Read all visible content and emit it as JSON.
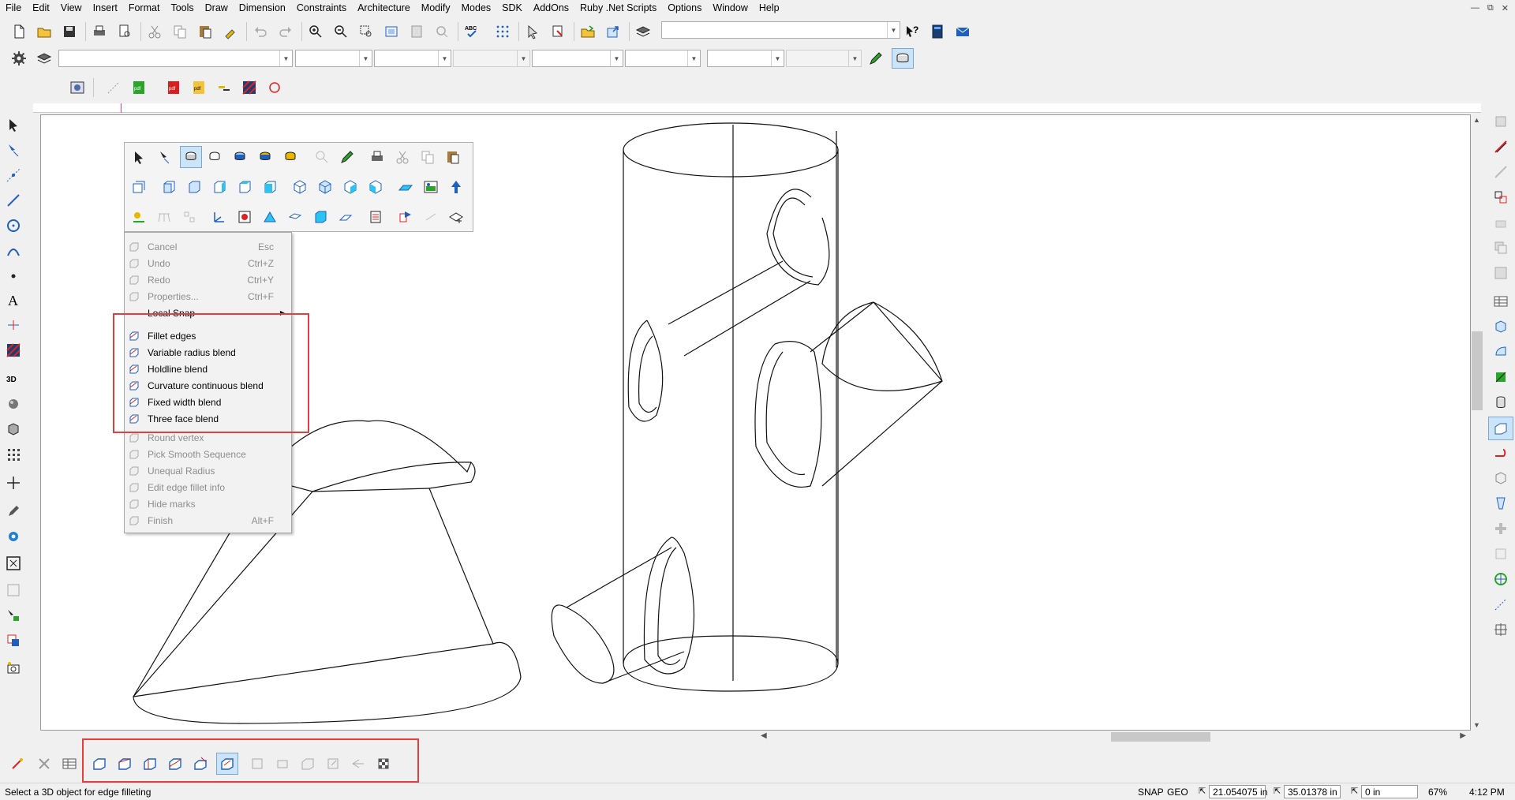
{
  "menu": [
    "File",
    "Edit",
    "View",
    "Insert",
    "Format",
    "Tools",
    "Draw",
    "Dimension",
    "Constraints",
    "Architecture",
    "Modify",
    "Modes",
    "SDK",
    "AddOns",
    "Ruby .Net Scripts",
    "Options",
    "Window",
    "Help"
  ],
  "toolbar1": {
    "abc_label": "ABC"
  },
  "context_menu": {
    "items": [
      {
        "label": "Cancel",
        "shortcut": "Esc",
        "enabled": false,
        "icon": "cancel-icon"
      },
      {
        "label": "Undo",
        "shortcut": "Ctrl+Z",
        "enabled": false,
        "icon": "undo-icon"
      },
      {
        "label": "Redo",
        "shortcut": "Ctrl+Y",
        "enabled": false,
        "icon": "redo-icon"
      },
      {
        "label": "Properties...",
        "shortcut": "Ctrl+F",
        "enabled": false,
        "icon": "properties-icon"
      },
      {
        "label": "Local Snap",
        "shortcut": "",
        "enabled": true,
        "icon": "",
        "submenu": true
      },
      {
        "label": "Fillet edges",
        "shortcut": "",
        "enabled": true,
        "icon": "fillet-edges-icon"
      },
      {
        "label": "Variable radius blend",
        "shortcut": "",
        "enabled": true,
        "icon": "variable-radius-blend-icon"
      },
      {
        "label": "Holdline blend",
        "shortcut": "",
        "enabled": true,
        "icon": "holdline-blend-icon"
      },
      {
        "label": "Curvature continuous blend",
        "shortcut": "",
        "enabled": true,
        "icon": "curvature-continuous-blend-icon"
      },
      {
        "label": "Fixed width blend",
        "shortcut": "",
        "enabled": true,
        "icon": "fixed-width-blend-icon"
      },
      {
        "label": "Three face blend",
        "shortcut": "",
        "enabled": true,
        "icon": "three-face-blend-icon"
      },
      {
        "label": "Round vertex",
        "shortcut": "",
        "enabled": false,
        "icon": "round-vertex-icon"
      },
      {
        "label": "Pick Smooth Sequence",
        "shortcut": "",
        "enabled": false,
        "icon": "pick-smooth-sequence-icon"
      },
      {
        "label": "Unequal Radius",
        "shortcut": "",
        "enabled": false,
        "icon": "unequal-radius-icon"
      },
      {
        "label": "Edit edge fillet info",
        "shortcut": "",
        "enabled": false,
        "icon": "edit-edge-fillet-info-icon"
      },
      {
        "label": "Hide marks",
        "shortcut": "",
        "enabled": false,
        "icon": "hide-marks-icon"
      },
      {
        "label": "Finish",
        "shortcut": "Alt+F",
        "enabled": false,
        "icon": "finish-icon"
      }
    ]
  },
  "status": {
    "prompt": "Select a 3D object for edge filleting",
    "snap": "SNAP",
    "geo": "GEO",
    "x": "21.054075 in",
    "y": "35.01378 in",
    "z": "0 in",
    "zoom": "67%",
    "time": "4:12 PM"
  },
  "colors": {
    "highlight": "#e04040",
    "accent_blue": "#1f5fbf"
  }
}
